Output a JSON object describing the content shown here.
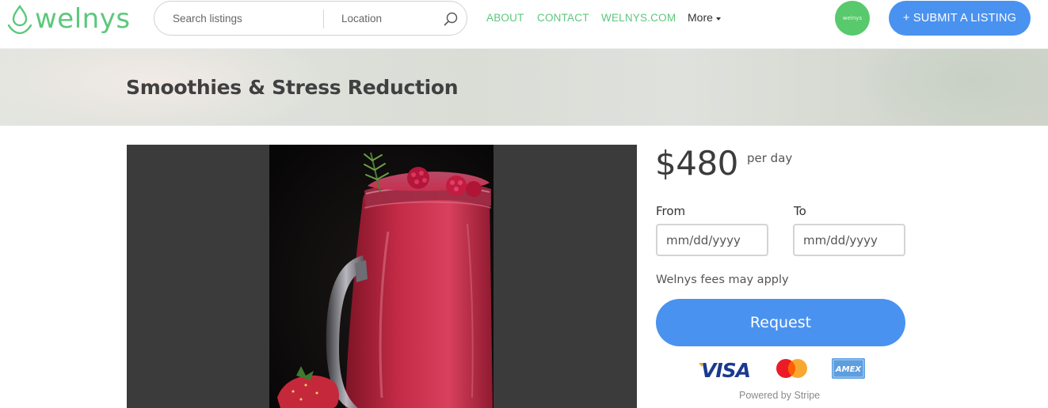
{
  "brand": {
    "name": "welnys",
    "avatar_label": "welnys",
    "brand_color": "#5cc87c",
    "accent_color": "#4a92f0"
  },
  "header": {
    "search": {
      "placeholder": "Search listings",
      "value": ""
    },
    "location": {
      "placeholder": "Location",
      "value": ""
    },
    "search_icon": "search-icon",
    "nav": {
      "about": "ABOUT",
      "contact": "CONTACT",
      "site": "WELNYS.COM",
      "more": "More"
    },
    "submit_label": "+ SUBMIT A LISTING"
  },
  "listing": {
    "title": "Smoothies & Stress Reduction",
    "price": "$480",
    "price_unit": "per day"
  },
  "booking": {
    "from_label": "From",
    "to_label": "To",
    "from_placeholder": "mm/dd/yyyy",
    "to_placeholder": "mm/dd/yyyy",
    "fees_note": "Welnys fees may apply",
    "request_label": "Request",
    "payment_icons": [
      "visa-icon",
      "mastercard-icon",
      "amex-icon"
    ],
    "visa_text": "VISA",
    "amex_text": "AMEX",
    "powered_by": "Powered by Stripe"
  }
}
